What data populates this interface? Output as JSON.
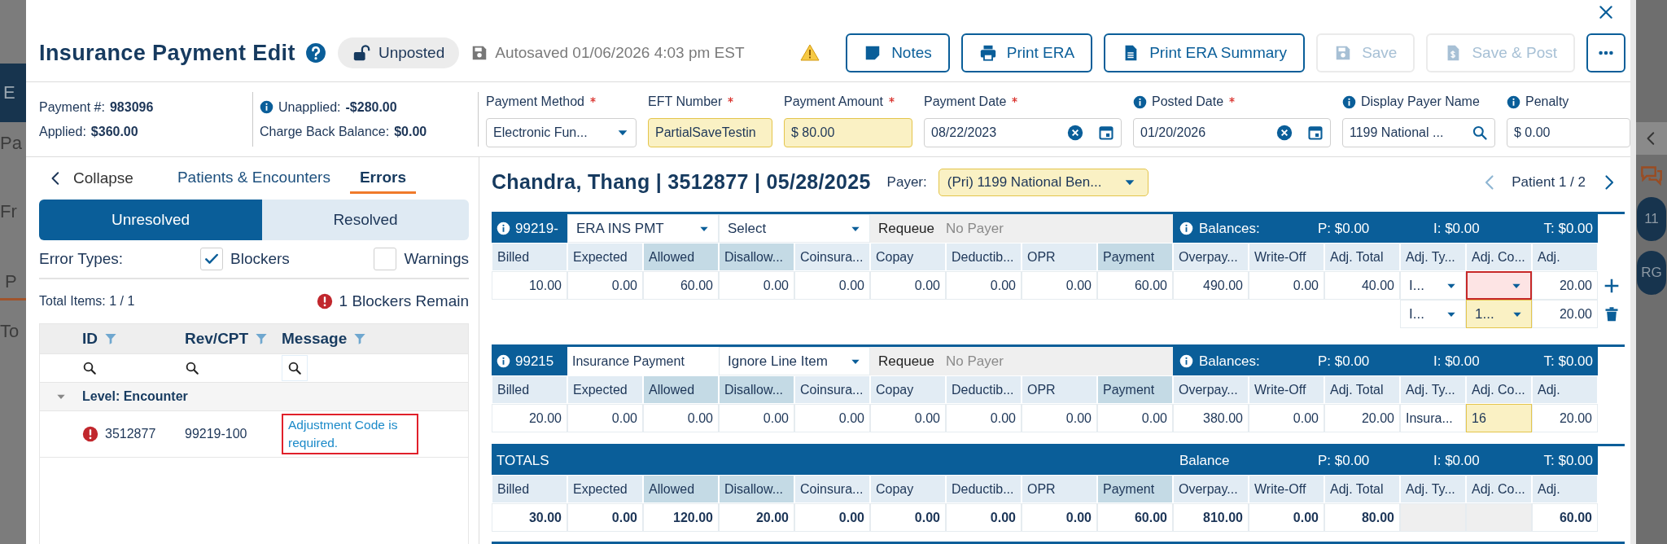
{
  "backdrop": {
    "left_texts": [
      "E",
      "Pa",
      "Fr",
      "P",
      "To"
    ],
    "right_badges": [
      "11",
      "RG"
    ]
  },
  "header": {
    "title": "Insurance Payment Edit",
    "status": {
      "label": "Unposted",
      "locked": false
    },
    "autosave": "Autosaved 01/06/2026 4:03 pm EST",
    "buttons": [
      {
        "kind": "notes",
        "label": "Notes",
        "disabled": false
      },
      {
        "kind": "print",
        "label": "Print ERA",
        "disabled": false
      },
      {
        "kind": "summary",
        "label": "Print ERA Summary",
        "disabled": false
      },
      {
        "kind": "save",
        "label": "Save",
        "disabled": true
      },
      {
        "kind": "post",
        "label": "Save & Post",
        "disabled": true
      }
    ]
  },
  "summary": [
    [
      {
        "label": "Payment #:",
        "value": "983096",
        "info": false
      },
      {
        "label": "Applied:",
        "value": "$360.00",
        "info": false
      }
    ],
    [
      {
        "label": "Unapplied:",
        "value": "-$280.00",
        "info": true
      },
      {
        "label": "Charge Back Balance:",
        "value": "$0.00",
        "info": false
      }
    ]
  ],
  "fields": [
    {
      "label": "Payment Method",
      "required": true,
      "info": false,
      "kind": "select",
      "value": "Electronic Fun...",
      "highlighted": false
    },
    {
      "label": "EFT Number",
      "required": true,
      "info": false,
      "kind": "text",
      "value": "PartialSaveTestin",
      "highlighted": true
    },
    {
      "label": "Payment Amount",
      "required": true,
      "info": false,
      "kind": "text",
      "value": "$ 80.00",
      "highlighted": true
    },
    {
      "label": "Payment Date",
      "required": true,
      "info": false,
      "kind": "date",
      "value": "08/22/2023",
      "highlighted": false
    },
    {
      "label": "Posted Date",
      "required": true,
      "info": true,
      "kind": "date",
      "value": "01/20/2026",
      "highlighted": false
    },
    {
      "label": "Display Payer Name",
      "required": false,
      "info": true,
      "kind": "search",
      "value": "1199 National ...",
      "highlighted": false
    },
    {
      "label": "Penalty",
      "required": false,
      "info": true,
      "kind": "text",
      "value": "$ 0.00",
      "highlighted": false
    }
  ],
  "side_panel": {
    "collapse": "Collapse",
    "tabs": [
      {
        "label": "Patients & Encounters",
        "selected": false
      },
      {
        "label": "Errors",
        "selected": true
      }
    ],
    "segments": [
      {
        "label": "Unresolved",
        "selected": true
      },
      {
        "label": "Resolved",
        "selected": false
      }
    ],
    "error_types_label": "Error Types:",
    "filters": [
      {
        "label": "Blockers",
        "checked": true
      },
      {
        "label": "Warnings",
        "checked": false
      }
    ],
    "total_items": "Total Items: 1 / 1",
    "blockers_remain": "1 Blockers Remain",
    "table": {
      "columns": [
        "ID",
        "Rev/CPT",
        "Message"
      ],
      "groups": [
        {
          "label": "Level: Encounter",
          "expanded": true,
          "rows": [
            {
              "id": "3512877",
              "code": "99219-100",
              "message": "Adjustment Code is required.",
              "flagged": true
            }
          ]
        }
      ]
    }
  },
  "encounter": {
    "title": "Chandra, Thang | 3512877 | 05/28/2025",
    "payer_label": "Payer:",
    "payer": "(Pri) 1199 National Ben...",
    "pager": {
      "label": "Patient 1 / 2",
      "prev_disabled": true,
      "next_disabled": false
    },
    "lines": [
      {
        "code": "99219-",
        "type": {
          "text": "ERA INS PMT",
          "kind": "select"
        },
        "action": {
          "text": "Select",
          "kind": "select"
        },
        "requeue": "Requeue",
        "requeue_payer": "No Payer",
        "balances": "Balances:",
        "p": "P: $0.00",
        "i": "I: $0.00",
        "t": "T: $0.00",
        "columns": [
          {
            "label": "Billed",
            "shaded": false
          },
          {
            "label": "Expected",
            "shaded": false
          },
          {
            "label": "Allowed",
            "shaded": true
          },
          {
            "label": "Disallow...",
            "shaded": true
          },
          {
            "label": "Coinsura...",
            "shaded": false
          },
          {
            "label": "Copay",
            "shaded": false
          },
          {
            "label": "Deductib...",
            "shaded": false
          },
          {
            "label": "OPR",
            "shaded": false
          },
          {
            "label": "Payment",
            "shaded": true
          },
          {
            "label": "Overpay...",
            "shaded": false
          },
          {
            "label": "Write-Off",
            "shaded": false
          },
          {
            "label": "Adj. Total",
            "shaded": false
          },
          {
            "label": "Adj. Ty...",
            "shaded": false
          },
          {
            "label": "Adj. Co...",
            "shaded": false
          },
          {
            "label": "Adj.",
            "shaded": false
          }
        ],
        "values": [
          "10.00",
          "0.00",
          "60.00",
          "0.00",
          "0.00",
          "0.00",
          "0.00",
          "0.00",
          "60.00",
          "490.00",
          "0.00",
          "40.00"
        ],
        "adjustments": [
          {
            "type": {
              "text": "I...",
              "kind": "select"
            },
            "code": {
              "kind": "select"
            },
            "invalid": true,
            "highlighted": false,
            "amount": "20.00",
            "addable": true,
            "removable": false
          },
          {
            "type": {
              "text": "I...",
              "kind": "select"
            },
            "code": {
              "text": "1...",
              "kind": "select"
            },
            "invalid": false,
            "highlighted": true,
            "amount": "20.00",
            "addable": false,
            "removable": true
          }
        ]
      },
      {
        "code": "99215",
        "type": {
          "text": "Insurance Payment",
          "kind": "text"
        },
        "action": {
          "text": "Ignore Line Item",
          "kind": "select"
        },
        "requeue": "Requeue",
        "requeue_payer": "No Payer",
        "balances": "Balances:",
        "p": "P: $0.00",
        "i": "I: $0.00",
        "t": "T: $0.00",
        "columns": [
          {
            "label": "Billed",
            "shaded": false
          },
          {
            "label": "Expected",
            "shaded": false
          },
          {
            "label": "Allowed",
            "shaded": true
          },
          {
            "label": "Disallow...",
            "shaded": true
          },
          {
            "label": "Coinsura...",
            "shaded": false
          },
          {
            "label": "Copay",
            "shaded": false
          },
          {
            "label": "Deductib...",
            "shaded": false
          },
          {
            "label": "OPR",
            "shaded": false
          },
          {
            "label": "Payment",
            "shaded": true
          },
          {
            "label": "Overpay...",
            "shaded": false
          },
          {
            "label": "Write-Off",
            "shaded": false
          },
          {
            "label": "Adj. Total",
            "shaded": false
          },
          {
            "label": "Adj. Ty...",
            "shaded": false
          },
          {
            "label": "Adj. Co...",
            "shaded": false
          },
          {
            "label": "Adj.",
            "shaded": false
          }
        ],
        "values": [
          "20.00",
          "0.00",
          "0.00",
          "0.00",
          "0.00",
          "0.00",
          "0.00",
          "0.00",
          "0.00",
          "380.00",
          "0.00",
          "20.00"
        ],
        "adjustments": [
          {
            "type": {
              "text": "Insura...",
              "kind": "text"
            },
            "code": {
              "text": "16",
              "kind": "text"
            },
            "invalid": false,
            "highlighted": true,
            "amount": "20.00",
            "addable": false,
            "removable": false
          }
        ]
      }
    ],
    "totals": {
      "title": "TOTALS",
      "balance": "Balance",
      "p": "P: $0.00",
      "i": "I: $0.00",
      "t": "T: $0.00",
      "columns": [
        {
          "label": "Billed",
          "shaded": false
        },
        {
          "label": "Expected",
          "shaded": false
        },
        {
          "label": "Allowed",
          "shaded": true
        },
        {
          "label": "Disallow...",
          "shaded": true
        },
        {
          "label": "Coinsura...",
          "shaded": false
        },
        {
          "label": "Copay",
          "shaded": false
        },
        {
          "label": "Deductib...",
          "shaded": false
        },
        {
          "label": "OPR",
          "shaded": false
        },
        {
          "label": "Payment",
          "shaded": true
        },
        {
          "label": "Overpay...",
          "shaded": false
        },
        {
          "label": "Write-Off",
          "shaded": false
        },
        {
          "label": "Adj. Total",
          "shaded": false
        },
        {
          "label": "Adj. Ty...",
          "shaded": false
        },
        {
          "label": "Adj. Co...",
          "shaded": false
        },
        {
          "label": "Adj.",
          "shaded": false
        }
      ],
      "cells": [
        {
          "kind": "value",
          "text": "30.00"
        },
        {
          "kind": "value",
          "text": "0.00"
        },
        {
          "kind": "value",
          "text": "120.00"
        },
        {
          "kind": "value",
          "text": "20.00"
        },
        {
          "kind": "value",
          "text": "0.00"
        },
        {
          "kind": "value",
          "text": "0.00"
        },
        {
          "kind": "value",
          "text": "0.00"
        },
        {
          "kind": "value",
          "text": "0.00"
        },
        {
          "kind": "value",
          "text": "60.00"
        },
        {
          "kind": "value",
          "text": "810.00"
        },
        {
          "kind": "value",
          "text": "0.00"
        },
        {
          "kind": "value",
          "text": "80.00"
        },
        {
          "kind": "empty"
        },
        {
          "kind": "empty"
        },
        {
          "kind": "value",
          "text": "60.00"
        }
      ]
    }
  }
}
